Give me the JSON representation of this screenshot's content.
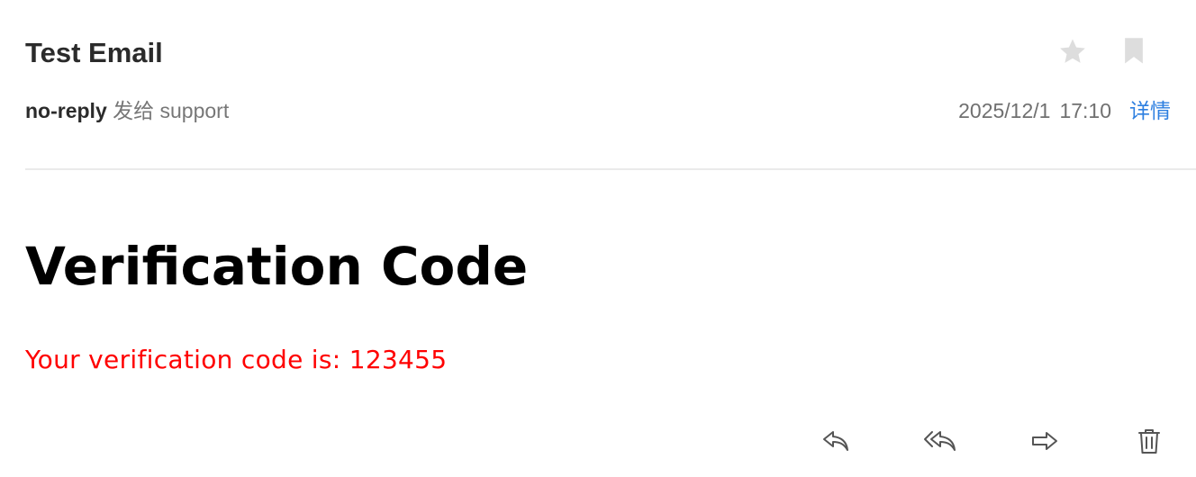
{
  "email": {
    "subject": "Test Email",
    "sender": "no-reply",
    "sent_to_word": "发给",
    "recipient": "support",
    "date": "2025/12/1",
    "time": "17:10",
    "details_label": "详情"
  },
  "body": {
    "heading": "Verification Code",
    "message": "Your verification code is: 123455"
  },
  "icons": {
    "star": "star-icon",
    "bookmark": "bookmark-icon",
    "reply": "reply-icon",
    "reply_all": "reply-all-icon",
    "forward": "forward-icon",
    "delete": "trash-icon"
  },
  "colors": {
    "link": "#2d7fe0",
    "body_text": "#ff0000",
    "icon_inactive": "#d8d8d8",
    "icon_action": "#555555"
  }
}
